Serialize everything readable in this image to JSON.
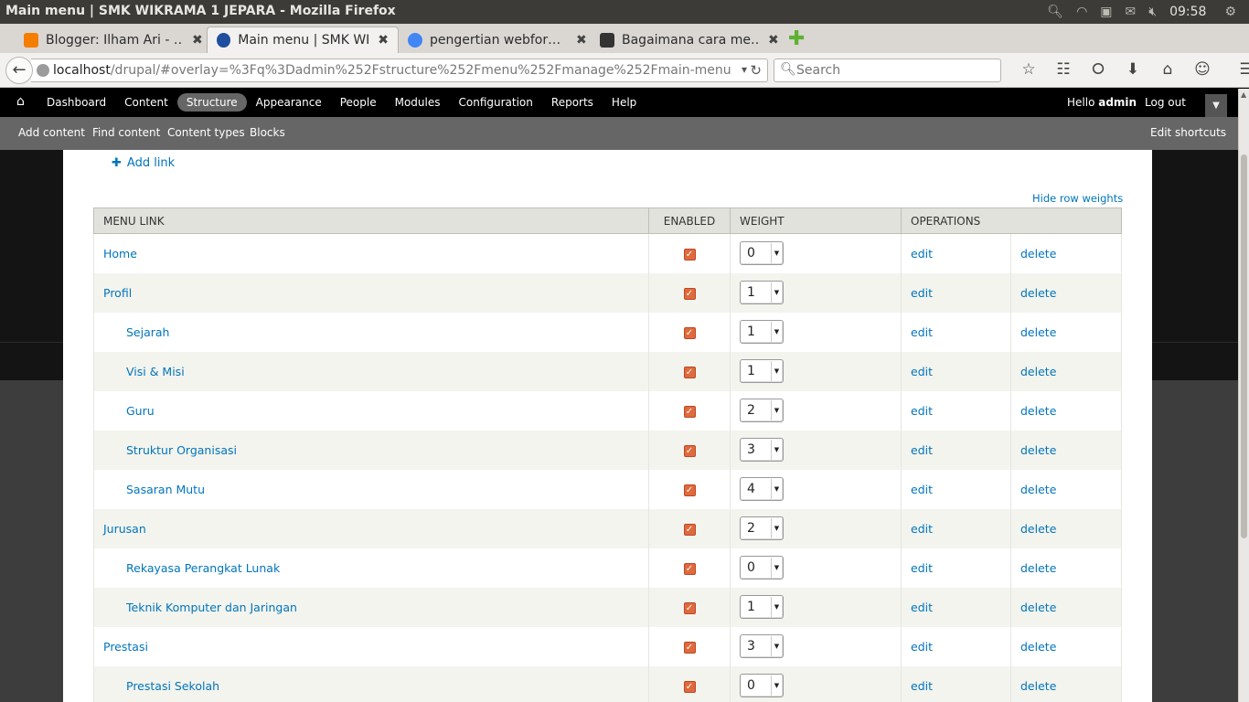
{
  "window": {
    "title": "Main menu | SMK WIKRAMA 1 JEPARA - Mozilla Firefox"
  },
  "tray": {
    "clock": "09:58"
  },
  "tabs": [
    {
      "label": "Blogger: Ilham Ari - …",
      "favicon_color": "#f57d00"
    },
    {
      "label": "Main menu | SMK WI…",
      "favicon_color": "#1f4e9e"
    },
    {
      "label": "pengertian webfor…",
      "favicon_color": "#4285f4"
    },
    {
      "label": "Bagaimana cara me…",
      "favicon_color": "#333333"
    }
  ],
  "nav": {
    "url_host": "localhost",
    "url_path": "/drupal/#overlay=%3Fq%3Dadmin%252Fstructure%252Fmenu%252Fmanage%252Fmain-menu",
    "search_placeholder": "Search"
  },
  "toolbar": {
    "items": [
      "Dashboard",
      "Content",
      "Structure",
      "Appearance",
      "People",
      "Modules",
      "Configuration",
      "Reports",
      "Help"
    ],
    "active": "Structure",
    "hello": "Hello ",
    "user": "admin",
    "logout": "Log out"
  },
  "shortcuts": {
    "items": [
      "Add content",
      "Find content",
      "Content types",
      "Blocks"
    ],
    "edit": "Edit shortcuts"
  },
  "page": {
    "add_link": "Add link",
    "hide_row_weights": "Hide row weights",
    "columns": {
      "menu_link": "MENU LINK",
      "enabled": "ENABLED",
      "weight": "WEIGHT",
      "operations": "OPERATIONS"
    },
    "edit_label": "edit",
    "delete_label": "delete",
    "rows": [
      {
        "name": "Home",
        "depth": 0,
        "enabled": true,
        "weight": "0"
      },
      {
        "name": "Profil",
        "depth": 0,
        "enabled": true,
        "weight": "1"
      },
      {
        "name": "Sejarah",
        "depth": 1,
        "enabled": true,
        "weight": "1"
      },
      {
        "name": "Visi & Misi",
        "depth": 1,
        "enabled": true,
        "weight": "1"
      },
      {
        "name": "Guru",
        "depth": 1,
        "enabled": true,
        "weight": "2"
      },
      {
        "name": "Struktur Organisasi",
        "depth": 1,
        "enabled": true,
        "weight": "3"
      },
      {
        "name": "Sasaran Mutu",
        "depth": 1,
        "enabled": true,
        "weight": "4"
      },
      {
        "name": "Jurusan",
        "depth": 0,
        "enabled": true,
        "weight": "2"
      },
      {
        "name": "Rekayasa Perangkat Lunak",
        "depth": 1,
        "enabled": true,
        "weight": "0"
      },
      {
        "name": "Teknik Komputer dan Jaringan",
        "depth": 1,
        "enabled": true,
        "weight": "1"
      },
      {
        "name": "Prestasi",
        "depth": 0,
        "enabled": true,
        "weight": "3"
      },
      {
        "name": "Prestasi Sekolah",
        "depth": 1,
        "enabled": true,
        "weight": "0"
      }
    ]
  }
}
